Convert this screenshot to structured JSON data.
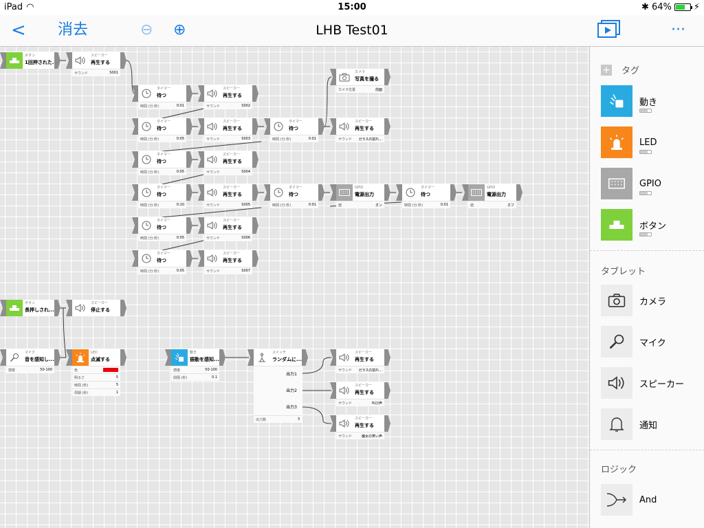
{
  "status": {
    "device": "iPad",
    "time": "15:00",
    "battery": "64%"
  },
  "nav": {
    "back": "<",
    "clear": "消去",
    "zoom_out": "⊖",
    "zoom_in": "⊕",
    "title": "LHB Test01",
    "more": "···"
  },
  "nodes": [
    {
      "id": "btn1",
      "type": "ボタン",
      "label": "1回押された...",
      "icon": "button-icon",
      "color": "#7fd13b",
      "props": []
    },
    {
      "id": "spk1",
      "type": "スピーカー",
      "label": "再生する",
      "icon": "speaker-icon",
      "props": [
        {
          "k": "サウンド",
          "v": "S001"
        }
      ]
    },
    {
      "id": "tm1",
      "type": "タイマー",
      "label": "待つ",
      "icon": "clock-icon",
      "props": [
        {
          "k": "時間 (分:秒)",
          "v": "0:01"
        }
      ]
    },
    {
      "id": "spk2",
      "type": "スピーカー",
      "label": "再生する",
      "icon": "speaker-icon",
      "props": [
        {
          "k": "サウンド",
          "v": "S002"
        }
      ]
    },
    {
      "id": "tm2",
      "type": "タイマー",
      "label": "待つ",
      "icon": "clock-icon",
      "props": [
        {
          "k": "時間 (分:秒)",
          "v": "0:05"
        }
      ]
    },
    {
      "id": "spk3",
      "type": "スピーカー",
      "label": "再生する",
      "icon": "speaker-icon",
      "props": [
        {
          "k": "サウンド",
          "v": "S003"
        }
      ]
    },
    {
      "id": "tm3",
      "type": "タイマー",
      "label": "待つ",
      "icon": "clock-icon",
      "props": [
        {
          "k": "時間 (分:秒)",
          "v": "0:05"
        }
      ]
    },
    {
      "id": "spk4",
      "type": "スピーカー",
      "label": "再生する",
      "icon": "speaker-icon",
      "props": [
        {
          "k": "サウンド",
          "v": "S004"
        }
      ]
    },
    {
      "id": "tm4",
      "type": "タイマー",
      "label": "待つ",
      "icon": "clock-icon",
      "props": [
        {
          "k": "時間 (分:秒)",
          "v": "0:10"
        }
      ]
    },
    {
      "id": "spk5",
      "type": "スピーカー",
      "label": "再生する",
      "icon": "speaker-icon",
      "props": [
        {
          "k": "サウンド",
          "v": "S005"
        }
      ]
    },
    {
      "id": "tm5",
      "type": "タイマー",
      "label": "待つ",
      "icon": "clock-icon",
      "props": [
        {
          "k": "時間 (分:秒)",
          "v": "0:05"
        }
      ]
    },
    {
      "id": "spk6",
      "type": "スピーカー",
      "label": "再生する",
      "icon": "speaker-icon",
      "props": [
        {
          "k": "サウンド",
          "v": "S006"
        }
      ]
    },
    {
      "id": "tm6",
      "type": "タイマー",
      "label": "待つ",
      "icon": "clock-icon",
      "props": [
        {
          "k": "時間 (分:秒)",
          "v": "0:05"
        }
      ]
    },
    {
      "id": "spk7",
      "type": "スピーカー",
      "label": "再生する",
      "icon": "speaker-icon",
      "props": [
        {
          "k": "サウンド",
          "v": "S007"
        }
      ]
    },
    {
      "id": "tm7",
      "type": "タイマー",
      "label": "待つ",
      "icon": "clock-icon",
      "props": [
        {
          "k": "時間 (分:秒)",
          "v": "0:01"
        }
      ]
    },
    {
      "id": "spk8",
      "type": "スピーカー",
      "label": "再生する",
      "icon": "speaker-icon",
      "props": [
        {
          "k": "サウンド",
          "v": "ガラスの割れ..."
        }
      ]
    },
    {
      "id": "cam1",
      "type": "カメラ",
      "label": "写真を撮る",
      "icon": "camera-icon",
      "props": [
        {
          "k": "カメラ位置",
          "v": "前面"
        }
      ]
    },
    {
      "id": "tm8",
      "type": "タイマー",
      "label": "待つ",
      "icon": "clock-icon",
      "props": [
        {
          "k": "時間 (分:秒)",
          "v": "0:01"
        }
      ]
    },
    {
      "id": "gpio1",
      "type": "GPIO",
      "label": "電源出力",
      "icon": "gpio-icon",
      "props": [
        {
          "k": "値",
          "v": "オン"
        }
      ]
    },
    {
      "id": "tm9",
      "type": "タイマー",
      "label": "待つ",
      "icon": "clock-icon",
      "props": [
        {
          "k": "時間 (分:秒)",
          "v": "0:01"
        }
      ]
    },
    {
      "id": "gpio2",
      "type": "GPIO",
      "label": "電源出力",
      "icon": "gpio-icon",
      "props": [
        {
          "k": "値",
          "v": "オフ"
        }
      ]
    },
    {
      "id": "btn2",
      "type": "ボタン",
      "label": "長押しされ...",
      "icon": "button-icon",
      "color": "#7fd13b",
      "props": []
    },
    {
      "id": "spk9",
      "type": "スピーカー",
      "label": "停止する",
      "icon": "speaker-icon",
      "props": []
    },
    {
      "id": "mic1",
      "type": "マイク",
      "label": "音を感知し...",
      "icon": "mic-icon",
      "props": [
        {
          "k": "感度",
          "v": "50-100"
        }
      ]
    },
    {
      "id": "led1",
      "type": "LED",
      "label": "点滅する",
      "icon": "led-icon",
      "color": "#f7861b",
      "props": [
        {
          "k": "色",
          "v": "",
          "swatch": "#e8000b"
        },
        {
          "k": "明るさ",
          "v": "5"
        },
        {
          "k": "時間 (秒)",
          "v": "5"
        },
        {
          "k": "周期 (秒)",
          "v": "1"
        }
      ]
    },
    {
      "id": "mot1",
      "type": "動き",
      "label": "振動を感知...",
      "icon": "motion-icon",
      "color": "#29abe2",
      "props": [
        {
          "k": "感度",
          "v": "50-100"
        },
        {
          "k": "間隔 (秒)",
          "v": "0.1"
        }
      ]
    },
    {
      "id": "sw1",
      "type": "スイッチ",
      "label": "ランダムに...",
      "icon": "switch-icon",
      "props": [
        {
          "k": "出力数",
          "v": "3"
        }
      ],
      "outputs": [
        "出力1",
        "出力2",
        "出力3"
      ]
    },
    {
      "id": "spk10",
      "type": "スピーカー",
      "label": "再生する",
      "icon": "speaker-icon",
      "props": [
        {
          "k": "サウンド",
          "v": "ガラスの割れ..."
        }
      ]
    },
    {
      "id": "spk11",
      "type": "スピーカー",
      "label": "再生する",
      "icon": "speaker-icon",
      "props": [
        {
          "k": "サウンド",
          "v": "叫び声"
        }
      ]
    },
    {
      "id": "spk12",
      "type": "スピーカー",
      "label": "再生する",
      "icon": "speaker-icon",
      "props": [
        {
          "k": "サウンド",
          "v": "魔女の笑い声"
        }
      ]
    }
  ],
  "sidebar": {
    "tags_header": "タグ",
    "tags": [
      {
        "label": "動き",
        "icon": "motion-icon",
        "color": "#29abe2"
      },
      {
        "label": "LED",
        "icon": "led-icon",
        "color": "#f7861b"
      },
      {
        "label": "GPIO",
        "icon": "gpio-icon",
        "color": "#a8a8a8"
      },
      {
        "label": "ボタン",
        "icon": "button-icon",
        "color": "#7fd13b"
      }
    ],
    "tablet_header": "タブレット",
    "tablet": [
      {
        "label": "カメラ",
        "icon": "camera-icon"
      },
      {
        "label": "マイク",
        "icon": "mic-icon"
      },
      {
        "label": "スピーカー",
        "icon": "speaker-icon"
      },
      {
        "label": "通知",
        "icon": "bell-icon"
      }
    ],
    "logic_header": "ロジック",
    "logic": [
      {
        "label": "And",
        "icon": "and-icon"
      }
    ]
  }
}
